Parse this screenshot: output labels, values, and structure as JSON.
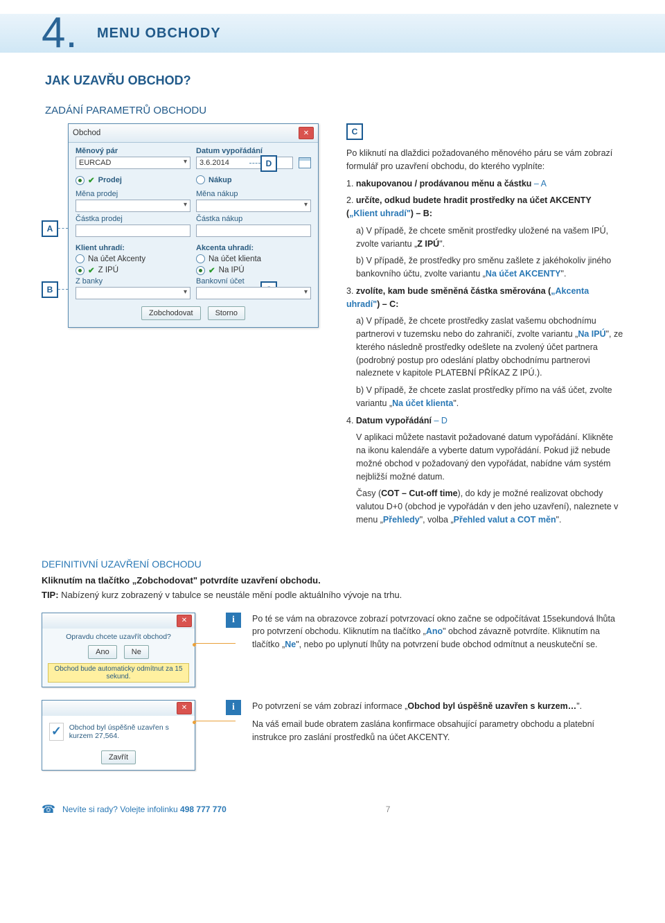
{
  "page": {
    "number_label": "4.",
    "title": "MENU OBCHODY",
    "subtitle": "JAK UZAVŘU OBCHOD?",
    "section1": "ZADÁNÍ PARAMETRŮ OBCHODU",
    "section2": "DEFINITIVNÍ UZAVŘENÍ OBCHODU",
    "page_number": "7",
    "footer_text": "Nevíte si rady? Volejte infolinku",
    "footer_phone": "498 777 770"
  },
  "callouts": {
    "A": "A",
    "B": "B",
    "C": "C",
    "CTop": "C",
    "D": "D"
  },
  "dialog": {
    "title": "Obchod",
    "pair_label": "Měnový pár",
    "pair_value": "EURCAD",
    "date_label": "Datum vypořádání",
    "date_value": "3.6.2014",
    "prodej": "Prodej",
    "nakup": "Nákup",
    "mena_prodej": "Měna prodej",
    "mena_nakup": "Měna nákup",
    "castka_prodej": "Částka prodej",
    "castka_nakup": "Částka nákup",
    "klient_uhradi": "Klient uhradí:",
    "akcenta_uhradi": "Akcenta uhradí:",
    "na_ucet_akcenty": "Na účet Akcenty",
    "na_ucet_klienta": "Na účet klienta",
    "z_ipu": "Z IPÚ",
    "na_ipu": "Na IPÚ",
    "z_banky": "Z banky",
    "bankovni_ucet": "Bankovní účet",
    "btn_trade": "Zobchodovat",
    "btn_cancel": "Storno"
  },
  "text": {
    "intro": "Po kliknutí na dlaždici požadovaného měnového páru se vám zobrazí formulář pro uzavření obchodu, do kterého vyplníte:",
    "step1_pre": "1. ",
    "step1_bold": "nakupovanou / prodávanou měnu a částku",
    "step1_letter": " – A",
    "step2_pre": "2. ",
    "step2_bold_a": "určíte, odkud budete hradit prostředky na účet AKCENTY (",
    "step2_bold_b": "„Klient uhradí\"",
    "step2_bold_c": ") – B:",
    "step2a": "a) V případě, že chcete směnit prostředky uložené na vašem IPÚ, zvolte variantu „",
    "step2a_bold": "Z IPÚ",
    "step2a_end": "\".",
    "step2b": "b) V případě, že prostředky pro směnu zašlete z jakéhokoliv jiného bankovního účtu, zvolte variantu „",
    "step2b_bold": "Na účet AKCENTY",
    "step2b_end": "\".",
    "step3_pre": "3. ",
    "step3_bold_a": "zvolíte, kam bude směněná částka směrována (",
    "step3_bold_b": "„Akcenta uhradí\"",
    "step3_bold_c": ") – C:",
    "step3a_a": "a) V případě, že chcete prostředky zaslat vašemu obchodnímu partnerovi v tuzemsku nebo do zahraničí, zvolte variantu „",
    "step3a_bold": "Na IPÚ",
    "step3a_b": "\", ze kterého následně prostředky odešlete na zvolený účet partnera (podrobný postup pro odeslání platby obchodnímu partnerovi naleznete v kapitole PLATEBNÍ PŘÍKAZ Z IPÚ.).",
    "step3b_a": "b) V případě, že chcete zaslat prostředky přímo na váš účet, zvolte variantu „",
    "step3b_bold": "Na účet klienta",
    "step3b_b": "\".",
    "step4_pre": "4. ",
    "step4_bold": "Datum vypořádání",
    "step4_letter": " – D",
    "step4_body_a": "V aplikaci můžete nastavit požadované datum vypořádání. Klikněte na ikonu kalendáře a vyberte datum vypořádání. Pokud již nebude možné obchod v požadovaný den vypořádat, nabídne vám systém nejbližší možné datum.",
    "step4_body_b_a": "Časy (",
    "step4_body_b_bold": "COT – Cut-off time",
    "step4_body_b_b": "), do kdy je možné realizovat obchody valutou D+0 (obchod je vypořádán v den jeho uzavření), naleznete v menu „",
    "step4_body_b_bold2": "Přehledy",
    "step4_body_b_c": "\", volba „",
    "step4_body_b_bold3": "Přehled valut a COT měn",
    "step4_body_b_d": "\"."
  },
  "def": {
    "line1_a": "Kliknutím na tlačítko „",
    "line1_bold": "Zobchodovat",
    "line1_b": "\" potvrdíte uzavření obchodu.",
    "tip_label": "TIP:",
    "tip_text": " Nabízený kurz zobrazený v tabulce se neustále mění podle aktuálního vývoje na trhu."
  },
  "confirm": {
    "question": "Opravdu chcete uzavřít obchod?",
    "yes": "Ano",
    "no": "Ne",
    "countdown": "Obchod bude automaticky odmítnut za 15 sekund."
  },
  "info1": {
    "a": "Po té se vám na obrazovce zobrazí potvrzovací okno začne se odpočítávat 15sekundová lhůta pro potvrzení obchodu. Kliknutím na tlačítko „",
    "bold1": "Ano",
    "b": "\" obchod závazně potvrdíte. Kliknutím na tlačítko „",
    "bold2": "Ne",
    "c": "\", nebo po uplynutí lhůty na potvrzení bude obchod odmítnut a neuskuteční se."
  },
  "success": {
    "msg": "Obchod byl úspěšně uzavřen s kurzem 27,564.",
    "btn": "Zavřít"
  },
  "info2": {
    "a": "Po potvrzení se vám zobrazí informace „",
    "bold1": "Obchod byl úspěšně uzavřen s kurzem…",
    "b": "\".",
    "c": "Na váš email bude obratem zaslána konfirmace obsahující parametry obchodu a platební instrukce pro zaslání prostředků na účet AKCENTY."
  }
}
